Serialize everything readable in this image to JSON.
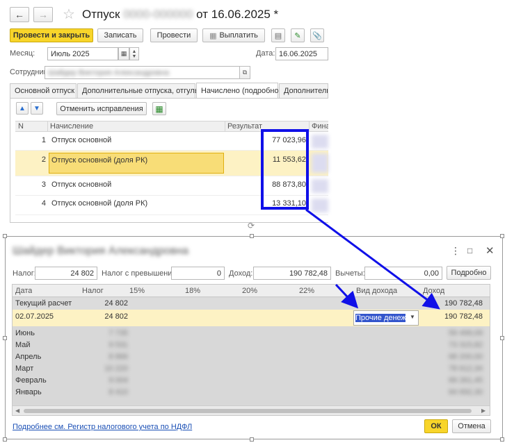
{
  "doc": {
    "title_prefix": "Отпуск",
    "title_blurred": "0000-000000",
    "title_suffix": "от 16.06.2025 *",
    "toolbar": {
      "post_close": "Провести и закрыть",
      "save": "Записать",
      "post": "Провести",
      "pay": "Выплатить"
    },
    "month_label": "Месяц:",
    "month_value": "Июль 2025",
    "date_label": "Дата:",
    "date_value": "16.06.2025",
    "employee_label": "Сотрудник:",
    "employee_value": "Шайдер Виктория Александровна",
    "tabs": [
      "Основной отпуск",
      "Дополнительные отпуска, отгулы",
      "Начислено (подробно)",
      "Дополнитель"
    ],
    "cancel_fixes": "Отменить исправления",
    "columns": {
      "n": "N",
      "accrual": "Начисление",
      "result": "Результат",
      "fin": "Фина"
    },
    "rows": [
      {
        "n": "1",
        "accrual": "Отпуск основной",
        "result": "77 023,96"
      },
      {
        "n": "2",
        "accrual": "Отпуск основной (доля РК)",
        "result": "11 553,62"
      },
      {
        "n": "3",
        "accrual": "Отпуск основной",
        "result": "88 873,80"
      },
      {
        "n": "4",
        "accrual": "Отпуск основной (доля РК)",
        "result": "13 331,10"
      }
    ]
  },
  "dialog": {
    "title": "Шайдер Виктория Александровна",
    "tax_label": "Налог:",
    "tax_value": "24 802",
    "tax_excess_label": "Налог с превышения:",
    "tax_excess_value": "0",
    "income_label": "Доход:",
    "income_value": "190 782,48",
    "deductions_label": "Вычеты:",
    "deductions_value": "0,00",
    "details_button": "Подробно",
    "columns": [
      "Дата",
      "Налог",
      "15%",
      "18%",
      "20%",
      "22%",
      "Вид дохода",
      "Доход"
    ],
    "current_row": {
      "date": "Текущий расчет",
      "tax": "24 802",
      "income": "190 782,48"
    },
    "selected_row": {
      "date": "02.07.2025",
      "tax": "24 802",
      "income_type": "Прочие денежнь",
      "income": "190 782,48"
    },
    "months": [
      {
        "date": "Июнь",
        "tax": "7 735",
        "income": "59 499,09"
      },
      {
        "date": "Май",
        "tax": "9 531",
        "income": "73 315,82"
      },
      {
        "date": "Апрель",
        "tax": "8 866",
        "income": "68 200,00"
      },
      {
        "date": "Март",
        "tax": "10 220",
        "income": "78 612,34"
      },
      {
        "date": "Февраль",
        "tax": "9 004",
        "income": "69 261,45"
      },
      {
        "date": "Январь",
        "tax": "8 410",
        "income": "64 692,30"
      }
    ],
    "link_text": "Подробнее см. Регистр налогового учета по НДФЛ",
    "ok": "ОК",
    "cancel": "Отмена"
  },
  "colors": {
    "accent_yellow": "#f8d52a",
    "highlight_blue": "#1010e8",
    "selected_row": "#fdf2c4",
    "link_blue": "#1a4fb5"
  }
}
